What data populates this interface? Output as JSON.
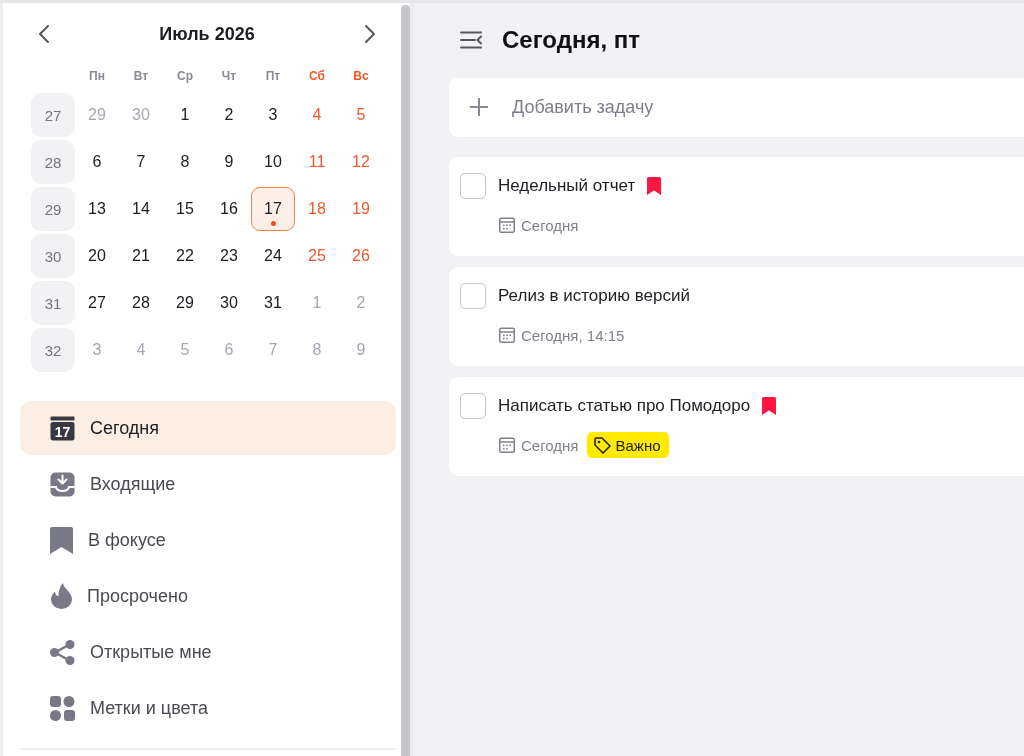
{
  "calendar": {
    "title": "Июль 2026",
    "weekdays": [
      {
        "label": "Пн",
        "weekend": false
      },
      {
        "label": "Вт",
        "weekend": false
      },
      {
        "label": "Ср",
        "weekend": false
      },
      {
        "label": "Чт",
        "weekend": false
      },
      {
        "label": "Пт",
        "weekend": false
      },
      {
        "label": "Сб",
        "weekend": true
      },
      {
        "label": "Вс",
        "weekend": true
      }
    ],
    "weeks": [
      {
        "number": "27",
        "days": [
          {
            "label": "29",
            "kind": "outside",
            "selected": false,
            "marked": false
          },
          {
            "label": "30",
            "kind": "outside",
            "selected": false,
            "marked": false
          },
          {
            "label": "1",
            "kind": "weekday",
            "selected": false,
            "marked": false
          },
          {
            "label": "2",
            "kind": "weekday",
            "selected": false,
            "marked": false
          },
          {
            "label": "3",
            "kind": "weekday",
            "selected": false,
            "marked": false
          },
          {
            "label": "4",
            "kind": "weekend",
            "selected": false,
            "marked": false
          },
          {
            "label": "5",
            "kind": "weekend",
            "selected": false,
            "marked": false
          }
        ]
      },
      {
        "number": "28",
        "days": [
          {
            "label": "6",
            "kind": "weekday",
            "selected": false,
            "marked": false
          },
          {
            "label": "7",
            "kind": "weekday",
            "selected": false,
            "marked": false
          },
          {
            "label": "8",
            "kind": "weekday",
            "selected": false,
            "marked": false
          },
          {
            "label": "9",
            "kind": "weekday",
            "selected": false,
            "marked": false
          },
          {
            "label": "10",
            "kind": "weekday",
            "selected": false,
            "marked": false
          },
          {
            "label": "11",
            "kind": "weekend",
            "selected": false,
            "marked": false
          },
          {
            "label": "12",
            "kind": "weekend",
            "selected": false,
            "marked": false
          }
        ]
      },
      {
        "number": "29",
        "days": [
          {
            "label": "13",
            "kind": "weekday",
            "selected": false,
            "marked": false
          },
          {
            "label": "14",
            "kind": "weekday",
            "selected": false,
            "marked": false
          },
          {
            "label": "15",
            "kind": "weekday",
            "selected": false,
            "marked": false
          },
          {
            "label": "16",
            "kind": "weekday",
            "selected": false,
            "marked": false
          },
          {
            "label": "17",
            "kind": "weekday",
            "selected": true,
            "marked": true
          },
          {
            "label": "18",
            "kind": "weekend",
            "selected": false,
            "marked": false
          },
          {
            "label": "19",
            "kind": "weekend",
            "selected": false,
            "marked": false
          }
        ]
      },
      {
        "number": "30",
        "days": [
          {
            "label": "20",
            "kind": "weekday",
            "selected": false,
            "marked": false
          },
          {
            "label": "21",
            "kind": "weekday",
            "selected": false,
            "marked": false
          },
          {
            "label": "22",
            "kind": "weekday",
            "selected": false,
            "marked": false
          },
          {
            "label": "23",
            "kind": "weekday",
            "selected": false,
            "marked": false
          },
          {
            "label": "24",
            "kind": "weekday",
            "selected": false,
            "marked": false
          },
          {
            "label": "25",
            "kind": "weekend",
            "selected": false,
            "marked": false
          },
          {
            "label": "26",
            "kind": "weekend",
            "selected": false,
            "marked": false
          }
        ]
      },
      {
        "number": "31",
        "days": [
          {
            "label": "27",
            "kind": "weekday",
            "selected": false,
            "marked": false
          },
          {
            "label": "28",
            "kind": "weekday",
            "selected": false,
            "marked": false
          },
          {
            "label": "29",
            "kind": "weekday",
            "selected": false,
            "marked": false
          },
          {
            "label": "30",
            "kind": "weekday",
            "selected": false,
            "marked": false
          },
          {
            "label": "31",
            "kind": "weekday",
            "selected": false,
            "marked": false
          },
          {
            "label": "1",
            "kind": "outside",
            "selected": false,
            "marked": false
          },
          {
            "label": "2",
            "kind": "outside",
            "selected": false,
            "marked": false
          }
        ]
      },
      {
        "number": "32",
        "days": [
          {
            "label": "3",
            "kind": "outside",
            "selected": false,
            "marked": false
          },
          {
            "label": "4",
            "kind": "outside",
            "selected": false,
            "marked": false
          },
          {
            "label": "5",
            "kind": "outside",
            "selected": false,
            "marked": false
          },
          {
            "label": "6",
            "kind": "outside",
            "selected": false,
            "marked": false
          },
          {
            "label": "7",
            "kind": "outside",
            "selected": false,
            "marked": false
          },
          {
            "label": "8",
            "kind": "outside",
            "selected": false,
            "marked": false
          },
          {
            "label": "9",
            "kind": "outside",
            "selected": false,
            "marked": false
          }
        ]
      }
    ]
  },
  "nav": {
    "items": [
      {
        "label": "Сегодня",
        "selected": true,
        "icon_label": "17"
      },
      {
        "label": "Входящие",
        "selected": false
      },
      {
        "label": "В фокусе",
        "selected": false
      },
      {
        "label": "Просрочено",
        "selected": false
      },
      {
        "label": "Открытые мне",
        "selected": false
      },
      {
        "label": "Метки и цвета",
        "selected": false
      }
    ]
  },
  "header": {
    "title": "Сегодня, пт"
  },
  "add_task": {
    "placeholder": "Добавить задачу"
  },
  "tasks": [
    {
      "title": "Недельный отчет",
      "checked": false,
      "flagged": true,
      "due": "Сегодня"
    },
    {
      "title": "Релиз в историю версий",
      "checked": false,
      "flagged": false,
      "due": "Сегодня, 14:15"
    },
    {
      "title": "Написать статью про Помодоро",
      "checked": false,
      "flagged": true,
      "due": "Сегодня",
      "tags": [
        {
          "label": "Важно",
          "color": "#ffea00"
        }
      ]
    }
  ]
}
